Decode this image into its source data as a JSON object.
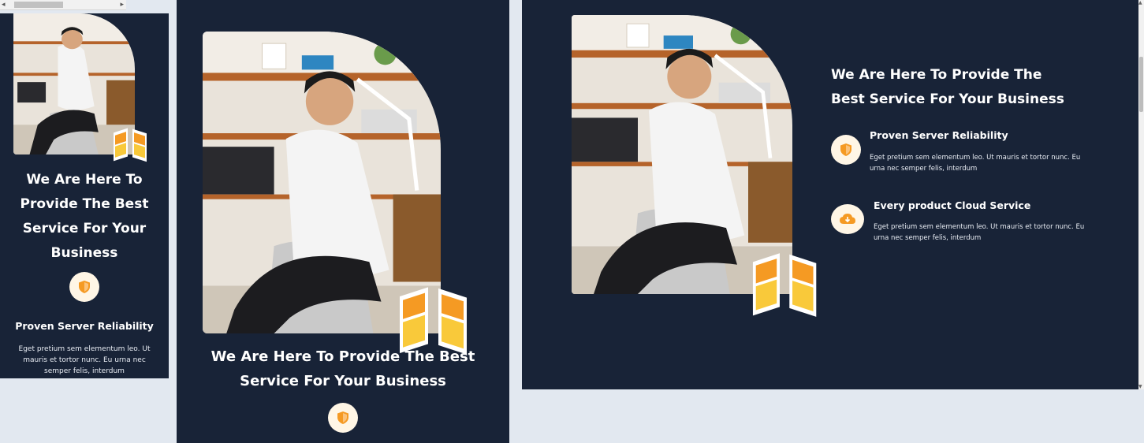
{
  "section": {
    "heading": "We Are Here To Provide The Best Service For Your Business"
  },
  "features": [
    {
      "icon": "shield-icon",
      "title": "Proven Server Reliability",
      "text": "Eget pretium sem elementum leo. Ut mauris et tortor nunc. Eu urna nec semper felis, interdum"
    },
    {
      "icon": "cloud-download-icon",
      "title": "Every product Cloud Service",
      "text": "Eget pretium sem elementum leo. Ut mauris et tortor nunc. Eu urna nec semper felis, interdum"
    }
  ],
  "colors": {
    "section_bg": "#182337",
    "page_bg": "#e2e8f0",
    "accent": "#f59a23",
    "badge_bg": "#fff6e6",
    "text": "#ffffff"
  }
}
